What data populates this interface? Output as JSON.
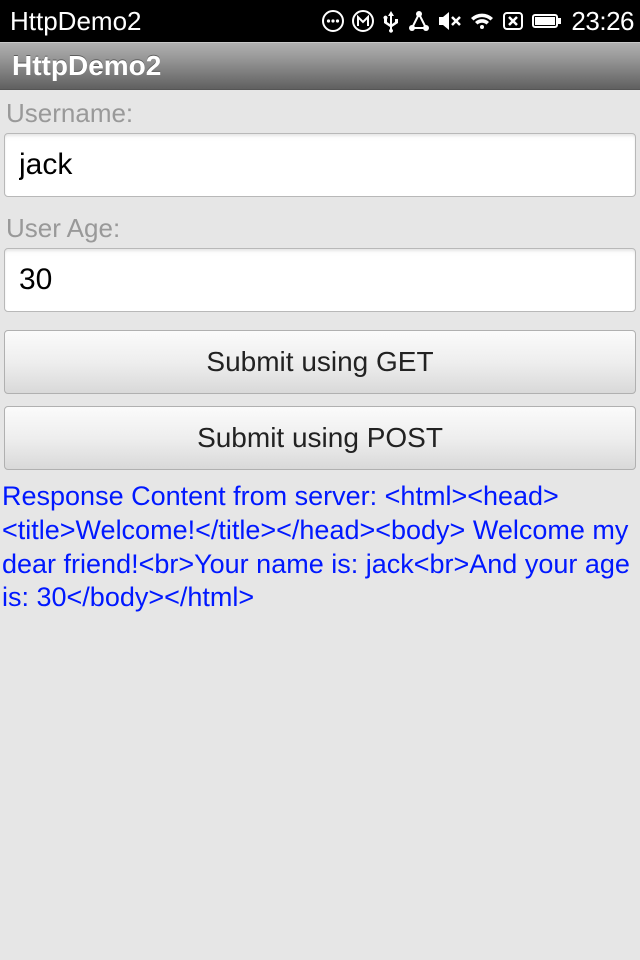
{
  "statusBar": {
    "appTitle": "HttpDemo2",
    "clock": "23:26"
  },
  "titleBar": {
    "title": "HttpDemo2"
  },
  "form": {
    "usernameLabel": "Username:",
    "usernameValue": "jack",
    "userAgeLabel": "User Age:",
    "userAgeValue": "30",
    "submitGetLabel": "Submit using GET",
    "submitPostLabel": "Submit using POST"
  },
  "response": {
    "text": "Response Content from server:\n<html><head><title>Welcome!</title></head><body> Welcome my dear friend!<br>Your name is: jack<br>And your age is: 30</body></html>"
  }
}
